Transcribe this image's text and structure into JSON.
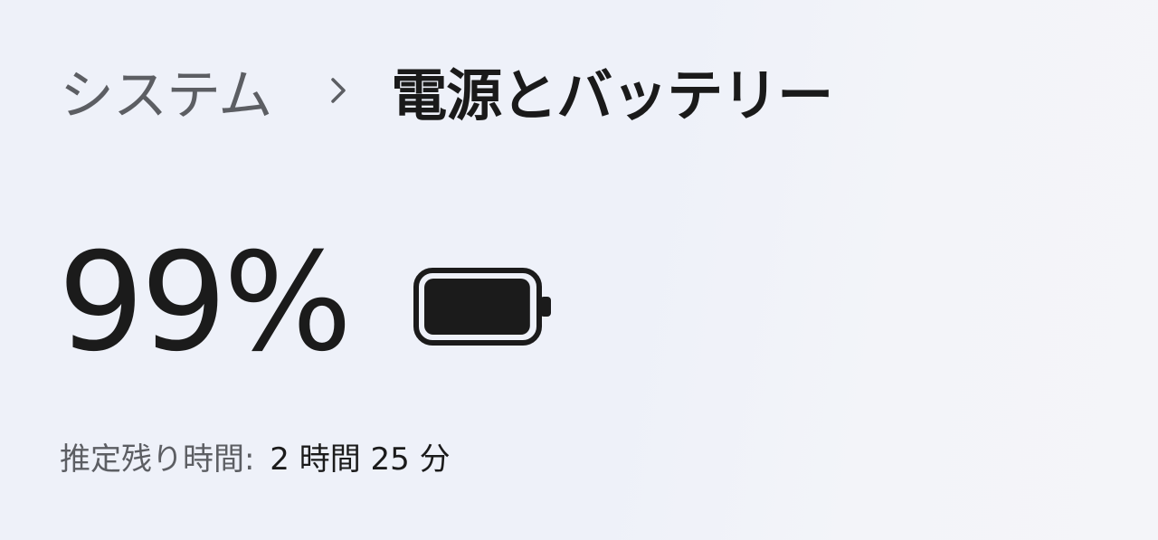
{
  "breadcrumb": {
    "parent": "システム",
    "separator_icon": "chevron-right-icon",
    "current": "電源とバッテリー"
  },
  "battery": {
    "percent_text": "99%",
    "level_percent": 99,
    "icon": "battery-full-icon",
    "estimate_label": "推定残り時間:",
    "estimate_value": "2 時間 25 分"
  }
}
